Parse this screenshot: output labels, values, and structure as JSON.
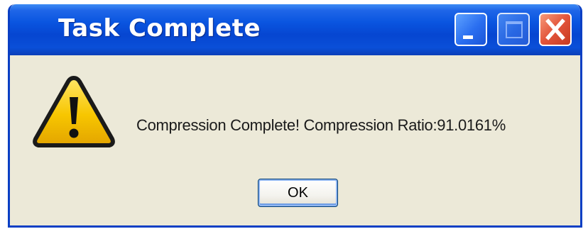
{
  "window": {
    "title": "Task Complete",
    "controls": {
      "minimize_icon": "minimize-icon",
      "maximize_icon": "maximize-icon",
      "close_icon": "close-icon"
    }
  },
  "dialog": {
    "icon": "warning-icon",
    "message": "Compression Complete! Compression Ratio:91.0161%",
    "ok_label": "OK"
  },
  "colors": {
    "titlebar_blue": "#0646d1",
    "close_red": "#e2543a",
    "dialog_bg": "#ece9d8",
    "warning_yellow": "#f5c400"
  }
}
